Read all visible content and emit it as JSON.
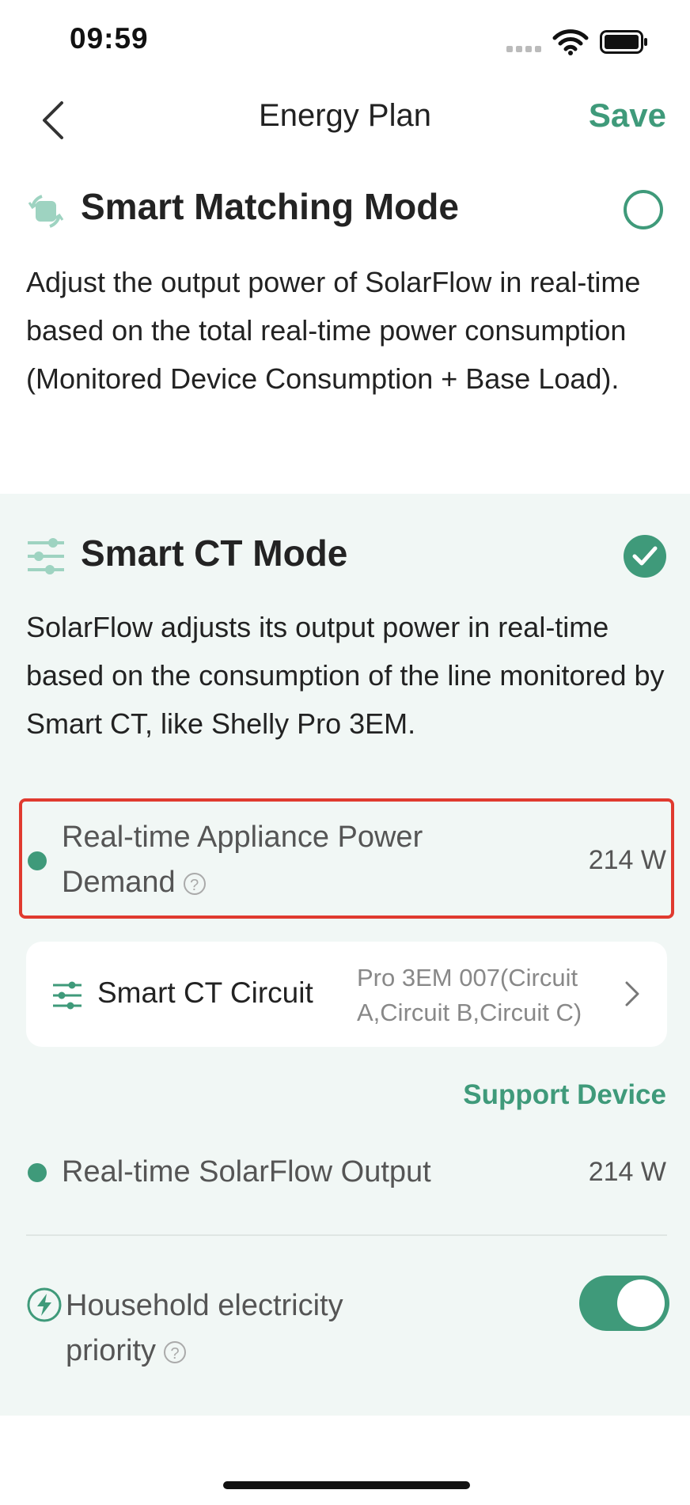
{
  "status_bar": {
    "time": "09:59"
  },
  "nav": {
    "title": "Energy Plan",
    "save_label": "Save"
  },
  "smart_matching": {
    "title": "Smart Matching Mode",
    "description": "Adjust the output power of SolarFlow in real-time based on the total real-time power consumption (Monitored Device Consumption + Base Load).",
    "selected": false
  },
  "smart_ct": {
    "title": "Smart CT Mode",
    "description": "SolarFlow adjusts its output power in real-time based on the consumption of the line monitored by Smart CT, like Shelly Pro 3EM.",
    "selected": true,
    "appliance_demand": {
      "label_line1": "Real-time Appliance Power",
      "label_line2": "Demand",
      "value": "214 W"
    },
    "circuit_card": {
      "label": "Smart CT Circuit",
      "value": "Pro 3EM 007(Circuit A,Circuit B,Circuit C)"
    },
    "support_device": "Support Device",
    "solarflow_output": {
      "label": "Real-time SolarFlow Output",
      "value": "214 W"
    },
    "household_priority": {
      "label_line1": "Household electricity",
      "label_line2": "priority",
      "enabled": true
    }
  },
  "colors": {
    "accent": "#3f9a7a",
    "panel_bg": "#f1f7f5",
    "highlight": "#e03a2f"
  }
}
